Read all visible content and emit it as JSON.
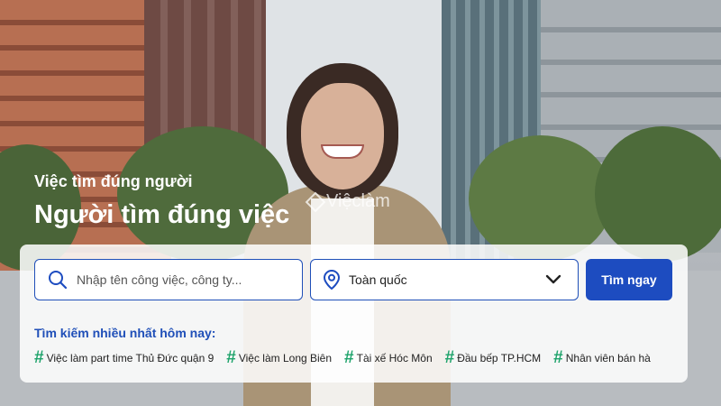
{
  "hero": {
    "subtitle": "Việc tìm đúng người",
    "title": "Người tìm đúng việc",
    "watermark": "Việclàm"
  },
  "search": {
    "keyword_placeholder": "Nhập tên công việc, công ty...",
    "location_value": "Toàn quốc",
    "button_label": "Tìm ngay"
  },
  "trending": {
    "title": "Tìm kiếm nhiều nhất hôm nay:",
    "hash": "#",
    "items": [
      "Việc làm part time Thủ Đức quận 9",
      "Việc làm Long Biên",
      "Tài xế Hóc Môn",
      "Đầu bếp TP.HCM",
      "Nhân viên bán hà"
    ]
  },
  "colors": {
    "primary": "#1d4cc0",
    "accent_green": "#1ea36b",
    "panel": "#ffffff"
  },
  "icons": [
    "search-icon",
    "location-pin-icon",
    "chevron-down-icon",
    "hashtag-icon"
  ]
}
